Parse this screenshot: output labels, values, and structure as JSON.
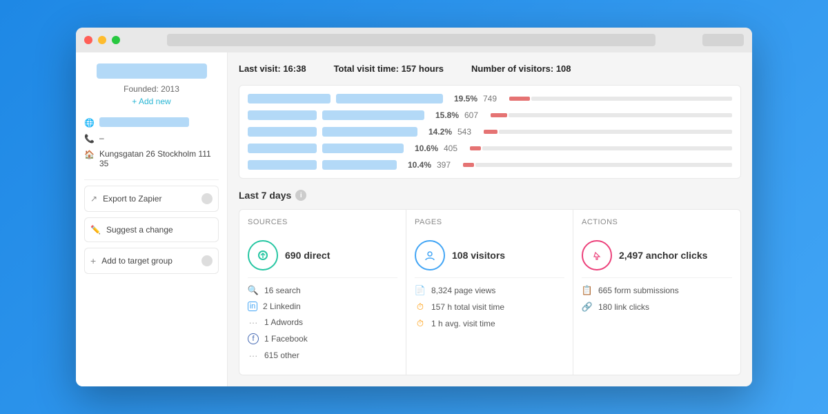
{
  "window": {
    "titlebar": {
      "buttons": [
        "close",
        "minimize",
        "maximize"
      ]
    }
  },
  "sidebar": {
    "founded_label": "Founded: 2013",
    "add_new_label": "+ Add new",
    "phone": "–",
    "address": "Kungsgatan 26 Stockholm 111 35",
    "actions": [
      {
        "label": "Export to Zapier",
        "icon": "share-icon"
      },
      {
        "label": "Suggest a change",
        "icon": "edit-icon"
      },
      {
        "label": "Add to target group",
        "icon": "plus-icon"
      }
    ]
  },
  "stats_header": {
    "last_visit_label": "Last visit:",
    "last_visit_value": "16:38",
    "total_time_label": "Total visit time:",
    "total_time_value": "157 hours",
    "visitors_label": "Number of visitors:",
    "visitors_value": "108"
  },
  "traffic_rows": [
    {
      "pct": "19.5%",
      "num": "749",
      "bar_left_w": 120,
      "bar_right_w": 160,
      "red_w": 18
    },
    {
      "pct": "15.8%",
      "num": "607",
      "bar_left_w": 100,
      "bar_right_w": 150,
      "red_w": 14
    },
    {
      "pct": "14.2%",
      "num": "543",
      "bar_left_w": 100,
      "bar_right_w": 140,
      "red_w": 12
    },
    {
      "pct": "10.6%",
      "num": "405",
      "bar_left_w": 100,
      "bar_right_w": 120,
      "red_w": 10
    },
    {
      "pct": "10.4%",
      "num": "397",
      "bar_left_w": 100,
      "bar_right_w": 110,
      "red_w": 10
    }
  ],
  "last7days": {
    "section_label": "Last 7 days",
    "columns": {
      "sources": {
        "header": "Sources",
        "main_stat": "690 direct",
        "sub_items": [
          {
            "icon": "search-icon",
            "text": "16 search"
          },
          {
            "icon": "linkedin-icon",
            "text": "2 Linkedin"
          },
          {
            "icon": "adwords-icon",
            "text": "1 Adwords"
          },
          {
            "icon": "facebook-icon",
            "text": "1 Facebook"
          },
          {
            "icon": "other-icon",
            "text": "615 other"
          }
        ]
      },
      "pages": {
        "header": "Pages",
        "main_stat": "108 visitors",
        "sub_items": [
          {
            "icon": "pageview-icon",
            "text": "8,324 page views"
          },
          {
            "icon": "clock-icon",
            "text": "157 h total visit time"
          },
          {
            "icon": "clock-icon",
            "text": "1 h avg. visit time"
          }
        ]
      },
      "actions": {
        "header": "Actions",
        "main_stat": "2,497 anchor clicks",
        "sub_items": [
          {
            "icon": "form-icon",
            "text": "665 form submissions"
          },
          {
            "icon": "link-icon",
            "text": "180 link clicks"
          }
        ]
      }
    }
  }
}
